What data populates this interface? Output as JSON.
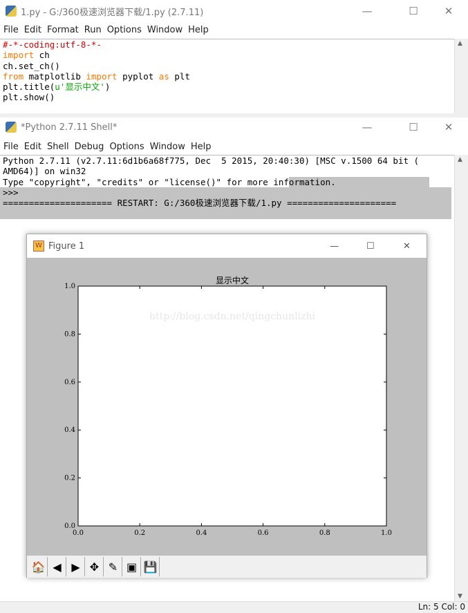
{
  "editor": {
    "title": "1.py - G:/360极速浏览器下载/1.py (2.7.11)",
    "menu": [
      "File",
      "Edit",
      "Format",
      "Run",
      "Options",
      "Window",
      "Help"
    ],
    "lines": [
      [
        {
          "t": "#-*-coding:utf-8-*-",
          "c": "cm"
        }
      ],
      [
        {
          "t": "import",
          "c": "kw"
        },
        {
          "t": " ch",
          "c": ""
        }
      ],
      [
        {
          "t": "ch.set_ch()",
          "c": ""
        }
      ],
      [
        {
          "t": "from",
          "c": "kw"
        },
        {
          "t": " matplotlib ",
          "c": ""
        },
        {
          "t": "import",
          "c": "kw"
        },
        {
          "t": " pyplot ",
          "c": ""
        },
        {
          "t": "as",
          "c": "kw"
        },
        {
          "t": " plt",
          "c": ""
        }
      ],
      [
        {
          "t": "plt.title(",
          "c": ""
        },
        {
          "t": "u'显示中文'",
          "c": "st"
        },
        {
          "t": ")",
          "c": ""
        }
      ],
      [
        {
          "t": "plt.show()",
          "c": ""
        }
      ]
    ]
  },
  "shell": {
    "title": "*Python 2.7.11 Shell*",
    "menu": [
      "File",
      "Edit",
      "Shell",
      "Debug",
      "Options",
      "Window",
      "Help"
    ],
    "line1": "Python 2.7.11 (v2.7.11:6d1b6a68f775, Dec  5 2015, 20:40:30) [MSC v.1500 64 bit (",
    "line2": "AMD64)] on win32",
    "line3a": "Type \"copyright\", \"credits\" or \"license()\" for more inf",
    "line3b": "ormation.",
    "prompt": ">>>",
    "restart": "===================== RESTART: G:/360极速浏览器下载/1.py =====================",
    "status": "Ln: 5  Col: 0"
  },
  "figure": {
    "title": "Figure 1",
    "watermark": "http://blog.csdn.net/qingchunlizhi",
    "toolbar": [
      {
        "name": "home-icon",
        "g": "🏠"
      },
      {
        "name": "back-icon",
        "g": "◀"
      },
      {
        "name": "forward-icon",
        "g": "▶"
      },
      {
        "name": "pan-icon",
        "g": "✥"
      },
      {
        "name": "zoom-rect-icon",
        "g": "✎"
      },
      {
        "name": "subplots-icon",
        "g": "▣"
      },
      {
        "name": "save-icon",
        "g": "💾"
      }
    ]
  },
  "chart_data": {
    "type": "line",
    "title": "显示中文",
    "series": [],
    "xlim": [
      0,
      1
    ],
    "ylim": [
      0,
      1
    ],
    "xticks": [
      "0.0",
      "0.2",
      "0.4",
      "0.6",
      "0.8",
      "1.0"
    ],
    "yticks": [
      "0.0",
      "0.2",
      "0.4",
      "0.6",
      "0.8",
      "1.0"
    ],
    "grid": false
  }
}
